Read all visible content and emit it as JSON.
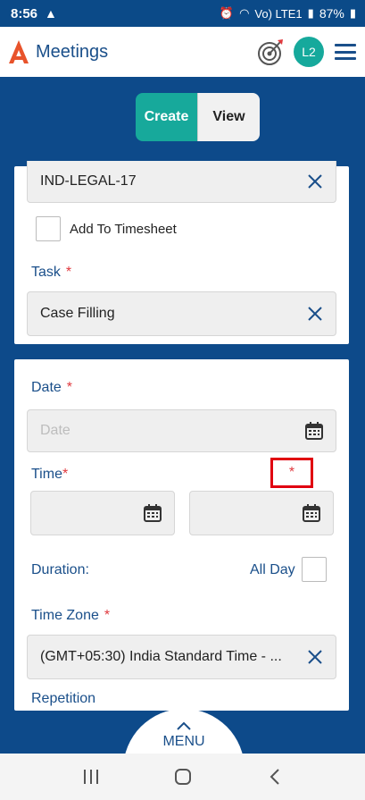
{
  "status": {
    "time": "8:56",
    "warning_icon": "warning-icon",
    "network": "Vo) LTE1",
    "battery": "87%"
  },
  "appbar": {
    "title": "Meetings",
    "avatar": "L2"
  },
  "toggle": {
    "create": "Create",
    "view": "View"
  },
  "project": {
    "value": "IND-LEGAL-17"
  },
  "timesheet": {
    "label": "Add To Timesheet"
  },
  "task": {
    "label": "Task",
    "required": "*",
    "value": "Case Filling"
  },
  "date": {
    "label": "Date",
    "required": "*",
    "placeholder": "Date"
  },
  "time": {
    "label": "Time",
    "required": "*",
    "end_required": "*"
  },
  "duration": {
    "label": "Duration:",
    "all_day": "All Day"
  },
  "timezone": {
    "label": "Time Zone",
    "required": "*",
    "value": "(GMT+05:30) India Standard Time - ..."
  },
  "repetition": {
    "label": "Repetition"
  },
  "menu": {
    "label": "MENU"
  },
  "colors": {
    "brand_blue": "#0d4a8a",
    "teal": "#17a99b",
    "required_red": "#e0393e"
  }
}
